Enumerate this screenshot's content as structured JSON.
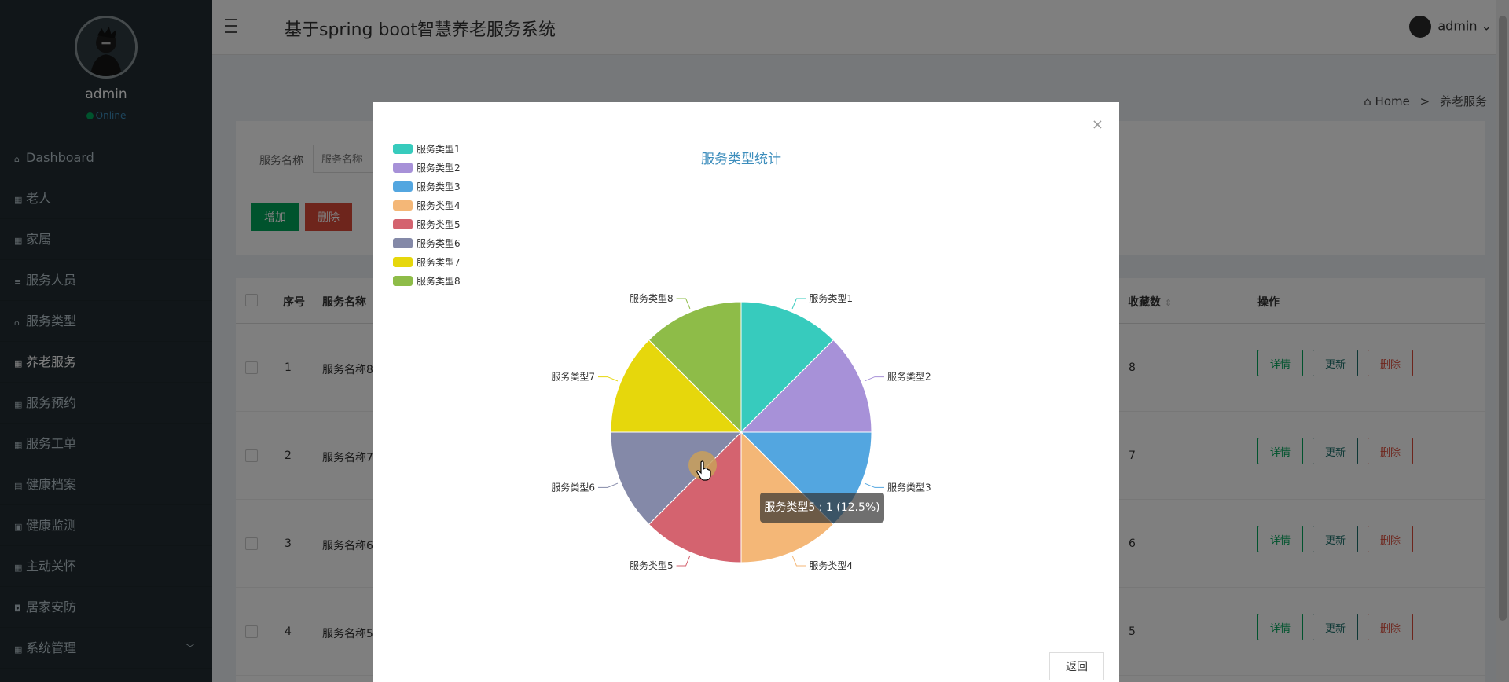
{
  "sidebar": {
    "username": "admin",
    "status": "Online",
    "items": [
      {
        "label": "Dashboard",
        "icon": "home-icon"
      },
      {
        "label": "老人",
        "icon": "grid-icon"
      },
      {
        "label": "家属",
        "icon": "grid-icon"
      },
      {
        "label": "服务人员",
        "icon": "list-icon"
      },
      {
        "label": "服务类型",
        "icon": "bank-icon"
      },
      {
        "label": "养老服务",
        "icon": "grid-icon",
        "active": true
      },
      {
        "label": "服务预约",
        "icon": "grid-icon"
      },
      {
        "label": "服务工单",
        "icon": "grid-icon"
      },
      {
        "label": "健康档案",
        "icon": "file-icon"
      },
      {
        "label": "健康监测",
        "icon": "check-icon"
      },
      {
        "label": "主动关怀",
        "icon": "grid-icon"
      },
      {
        "label": "居家安防",
        "icon": "shield-icon"
      },
      {
        "label": "系统管理",
        "icon": "grid-icon",
        "expandable": true
      }
    ]
  },
  "header": {
    "title": "基于spring boot智慧养老服务系统",
    "user": "admin"
  },
  "breadcrumb": {
    "home": "Home",
    "current": "养老服务"
  },
  "search": {
    "label": "服务名称",
    "placeholder": "服务名称",
    "add_label": "增加",
    "delete_label": "删除"
  },
  "table": {
    "headers": {
      "index": "序号",
      "name": "服务名称",
      "favorites": "收藏数",
      "actions": "操作"
    },
    "rows": [
      {
        "index": "1",
        "name": "服务名称8",
        "favorites": "8"
      },
      {
        "index": "2",
        "name": "服务名称7",
        "favorites": "7"
      },
      {
        "index": "3",
        "name": "服务名称6",
        "favorites": "6"
      },
      {
        "index": "4",
        "name": "服务名称5",
        "favorites": "5"
      }
    ],
    "action_labels": {
      "detail": "详情",
      "update": "更新",
      "delete": "删除"
    }
  },
  "modal": {
    "close": "×",
    "back": "返回",
    "tooltip": "服务类型5 : 1 (12.5%)"
  },
  "colors": {
    "sidebar_bg": "#222d32",
    "add_btn": "#00a65a",
    "delete_btn": "#dd4b39",
    "chart_title": "#3c8dbc"
  },
  "chart_data": {
    "type": "pie",
    "title": "服务类型统计",
    "legend_position": "top-left",
    "categories": [
      "服务类型1",
      "服务类型2",
      "服务类型3",
      "服务类型4",
      "服务类型5",
      "服务类型6",
      "服务类型7",
      "服务类型8"
    ],
    "values": [
      1,
      1,
      1,
      1,
      1,
      1,
      1,
      1
    ],
    "colors": [
      "#37cbbd",
      "#a791d8",
      "#53a6e0",
      "#f4b777",
      "#d4636f",
      "#8489a8",
      "#e6d70c",
      "#8ebc48"
    ]
  }
}
